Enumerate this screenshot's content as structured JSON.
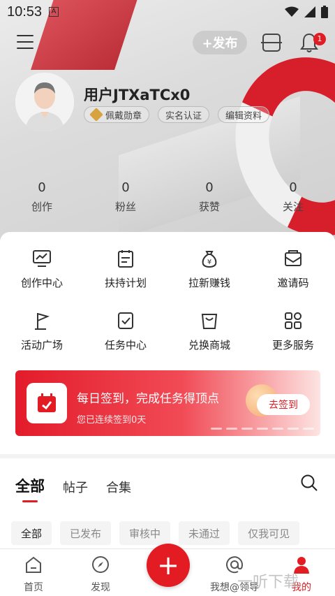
{
  "status_bar": {
    "time": "10:53",
    "indicator": "A"
  },
  "toolbar": {
    "publish_label": "+发布",
    "notification_count": "1"
  },
  "profile": {
    "username": "用户JTXaTCx0",
    "tags": [
      "佩戴勋章",
      "实名认证",
      "编辑资料"
    ]
  },
  "stats": [
    {
      "num": "0",
      "label": "创作"
    },
    {
      "num": "0",
      "label": "粉丝"
    },
    {
      "num": "0",
      "label": "获赞"
    },
    {
      "num": "0",
      "label": "关注"
    }
  ],
  "grid": [
    {
      "label": "创作中心",
      "icon": "monitor-icon"
    },
    {
      "label": "扶持计划",
      "icon": "clipboard-icon"
    },
    {
      "label": "拉新赚钱",
      "icon": "money-bag-icon"
    },
    {
      "label": "邀请码",
      "icon": "mail-icon"
    },
    {
      "label": "活动广场",
      "icon": "flag-icon"
    },
    {
      "label": "任务中心",
      "icon": "task-check-icon"
    },
    {
      "label": "兑换商城",
      "icon": "shopping-bag-icon"
    },
    {
      "label": "更多服务",
      "icon": "grid-icon"
    }
  ],
  "banner": {
    "title": "每日签到，完成任务得顶点",
    "subtitle": "您已连续签到0天",
    "button": "去签到"
  },
  "tabs": [
    "全部",
    "帖子",
    "合集"
  ],
  "filters": [
    "全部",
    "已发布",
    "审核中",
    "未通过",
    "仅我可见"
  ],
  "bottom_nav": [
    {
      "label": "首页",
      "icon": "home-icon"
    },
    {
      "label": "发现",
      "icon": "compass-icon"
    },
    {
      "label": "我想@领导",
      "icon": "at-icon"
    },
    {
      "label": "我的",
      "icon": "user-icon"
    }
  ],
  "watermark": "一听下载",
  "colors": {
    "accent": "#e31b23"
  }
}
